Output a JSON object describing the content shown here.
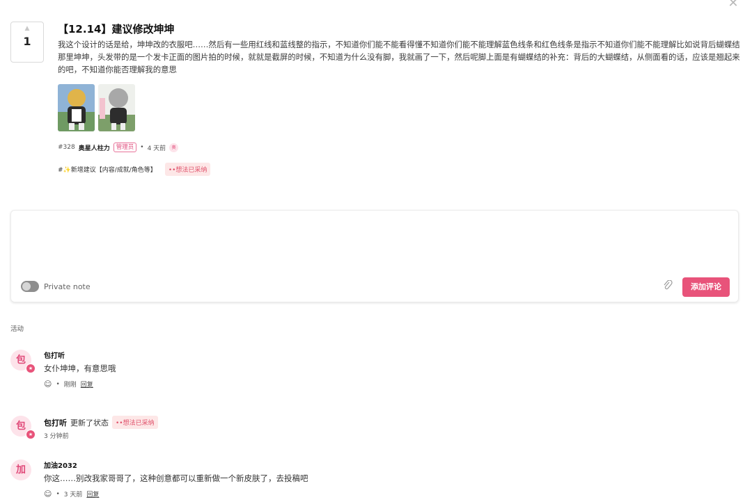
{
  "post": {
    "vote_count": "1",
    "title": "【12.14】建议修改坤坤",
    "body": "我这个设计的话是给，坤坤改的衣服吧……然后有一些用红线和蓝线整的指示，不知道你们能不能看得懂不知道你们能不能理解蓝色线条和红色线条是指示不知道你们能不能理解比如说背后蝴蝶结那里坤坤，头发带的是一个发卡正面的图片拍的时候，就就是截屏的时候，不知道为什么没有脚，我就画了一下，然后呢脚上面是有蝴蝶结的补充：背后的大蝴蝶结，从侧面看的话，应该是翘起来的吧，不知道你能否理解我的意思",
    "id": "#328",
    "author": "奥星人柱力",
    "role_badge": "管理员",
    "separator": "•",
    "time": "4 天前",
    "category": "#✨新增建议【内容/成就/角色等】",
    "status": "••想法已采纳"
  },
  "comment_box": {
    "private_note_label": "Private note",
    "add_button": "添加评论"
  },
  "activity": {
    "label": "活动",
    "items": [
      {
        "avatar": "包",
        "name": "包打听",
        "text": "女仆坤坤，有意思哦",
        "time": "刚刚",
        "reply": "回复"
      },
      {
        "avatar": "包",
        "name": "包打听",
        "action": "更新了状态",
        "status": "••想法已采纳",
        "time": "3 分钟前"
      },
      {
        "avatar": "加",
        "name": "加油2032",
        "text": "你这……别改我家哥哥了，这种创意都可以重新做一个新皮肤了，去投稿吧",
        "time": "3 天前",
        "reply": "回复"
      }
    ]
  },
  "colors": {
    "accent": "#e8537a",
    "status_bg": "#fde7e7"
  }
}
